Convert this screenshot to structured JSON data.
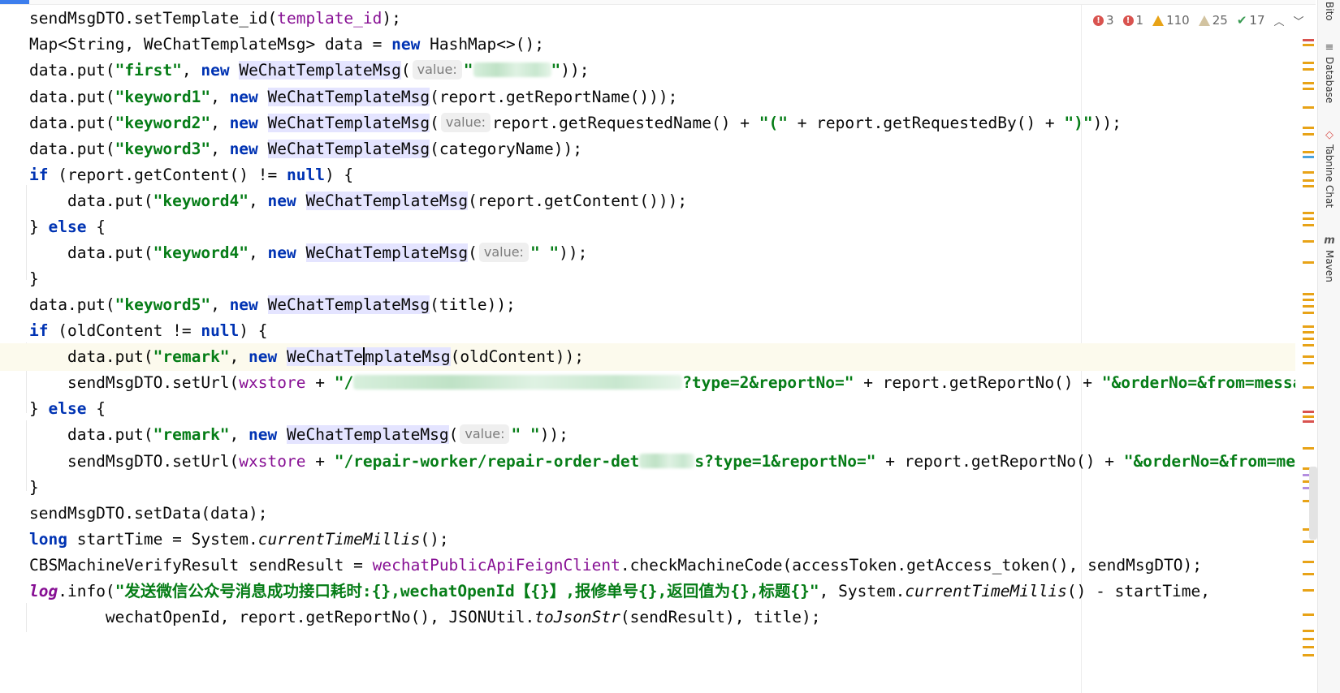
{
  "window": {
    "active_line": 14
  },
  "inspections": {
    "errors_a": "3",
    "errors_b": "1",
    "warnings": "110",
    "weak_warnings": "25",
    "typos": "17",
    "prev_icon": "chevron-up-icon",
    "next_icon": "chevron-down-icon"
  },
  "tool_windows": [
    {
      "label": "Bito",
      "icon": ""
    },
    {
      "label": "Database",
      "icon": "database-icon"
    },
    {
      "label": "Tabnine Chat",
      "icon": "tabnine-icon"
    },
    {
      "label": "Maven",
      "icon": "maven-icon"
    }
  ],
  "code": {
    "l1": {
      "a": "sendMsgDTO.setTemplate_id(",
      "b": "template_id",
      "c": ");"
    },
    "l2": {
      "a": "Map<String, WeChatTemplateMsg> data = ",
      "kw": "new",
      "b": " HashMap<>();"
    },
    "l3": {
      "a": "data.put(",
      "s1": "\"first\"",
      "b": ", ",
      "kw": "new",
      "c": " ",
      "cls": "WeChatTemplateMsg",
      "d": "(",
      "hint": "value:",
      "s2": "\"",
      "e": "));"
    },
    "l4": {
      "a": "data.put(",
      "s1": "\"keyword1\"",
      "b": ", ",
      "kw": "new",
      "c": " ",
      "cls": "WeChatTemplateMsg",
      "d": "(report.getReportName()));"
    },
    "l5": {
      "a": "data.put(",
      "s1": "\"keyword2\"",
      "b": ", ",
      "kw": "new",
      "c": " ",
      "cls": "WeChatTemplateMsg",
      "d": "(",
      "hint": "value:",
      "e": "report.getRequestedName() + ",
      "s2": "\"(\"",
      "f": " + report.getRequestedBy() + ",
      "s3": "\")\"",
      "g": "));"
    },
    "l6": {
      "a": "data.put(",
      "s1": "\"keyword3\"",
      "b": ", ",
      "kw": "new",
      "c": " ",
      "cls": "WeChatTemplateMsg",
      "d": "(categoryName));"
    },
    "l7": {
      "kw1": "if",
      "a": " (report.getContent() != ",
      "kw2": "null",
      "b": ") {"
    },
    "l8": {
      "a": "    data.put(",
      "s1": "\"keyword4\"",
      "b": ", ",
      "kw": "new",
      "c": " ",
      "cls": "WeChatTemplateMsg",
      "d": "(report.getContent()));"
    },
    "l9": {
      "a": "} ",
      "kw": "else",
      "b": " {"
    },
    "l10": {
      "a": "    data.put(",
      "s1": "\"keyword4\"",
      "b": ", ",
      "kw": "new",
      "c": " ",
      "cls": "WeChatTemplateMsg",
      "d": "(",
      "hint": "value:",
      "s2": "\" \"",
      "e": "));"
    },
    "l11": {
      "a": "}"
    },
    "l12": {
      "a": "data.put(",
      "s1": "\"keyword5\"",
      "b": ", ",
      "kw": "new",
      "c": " ",
      "cls": "WeChatTemplateMsg",
      "d": "(title));"
    },
    "l13": {
      "kw1": "if",
      "a": " (oldContent != ",
      "kw2": "null",
      "b": ") {"
    },
    "l14": {
      "a": "    data.put(",
      "s1": "\"remark\"",
      "b": ", ",
      "kw": "new",
      "c": " ",
      "cls_a": "WeChatTe",
      "cls_b": "mplateMsg",
      "d": "(oldContent));"
    },
    "l15": {
      "a": "    sendMsgDTO.setUrl(",
      "fld": "wxstore",
      "b": " + ",
      "s1": "\"/",
      "s2": "?type=2&reportNo=\"",
      "c": " + report.getReportNo() + ",
      "s3": "\"&orderNo=&from=messa"
    },
    "l16": {
      "a": "} ",
      "kw": "else",
      "b": " {"
    },
    "l17": {
      "a": "    data.put(",
      "s1": "\"remark\"",
      "b": ", ",
      "kw": "new",
      "c": " ",
      "cls": "WeChatTemplateMsg",
      "d": "(",
      "hint": "value:",
      "s2": "\" \"",
      "e": "));"
    },
    "l18": {
      "a": "    sendMsgDTO.setUrl(",
      "fld": "wxstore",
      "b": " + ",
      "s1": "\"/repair-worker/repair-order-det",
      "s2": "s?type=1&reportNo=\"",
      "c": " + report.getReportNo() + ",
      "s3": "\"&orderNo=&from=mess"
    },
    "l19": {
      "a": "}"
    },
    "l20": {
      "a": "sendMsgDTO.setData(data);"
    },
    "l21": {
      "kw": "long",
      "a": " startTime = System.",
      "it": "currentTimeMillis",
      "b": "();"
    },
    "l22": {
      "a": "CBSMachineVerifyResult sendResult = ",
      "fld": "wechatPublicApiFeignClient",
      "b": ".checkMachineCode(accessToken.getAccess_token(), sendMsgDTO);"
    },
    "l23": {
      "log": "log",
      "a": ".info(",
      "s1": "\"发送微信公众号消息成功接口耗时:{},wechatOpenId【{}】,报修单号{},返回值为{},标题{}\"",
      "b": ", System.",
      "it": "currentTimeMillis",
      "c": "() - startTime,"
    },
    "l24": {
      "a": "        wechatOpenId, report.getReportNo(), JSONUtil.",
      "it": "toJsonStr",
      "b": "(sendResult), title);"
    }
  },
  "colors": {
    "keyword": "#0033b3",
    "string": "#067d17",
    "field": "#871094",
    "class_highlight": "#e4e4ff",
    "caret_line": "#fcfaed"
  }
}
